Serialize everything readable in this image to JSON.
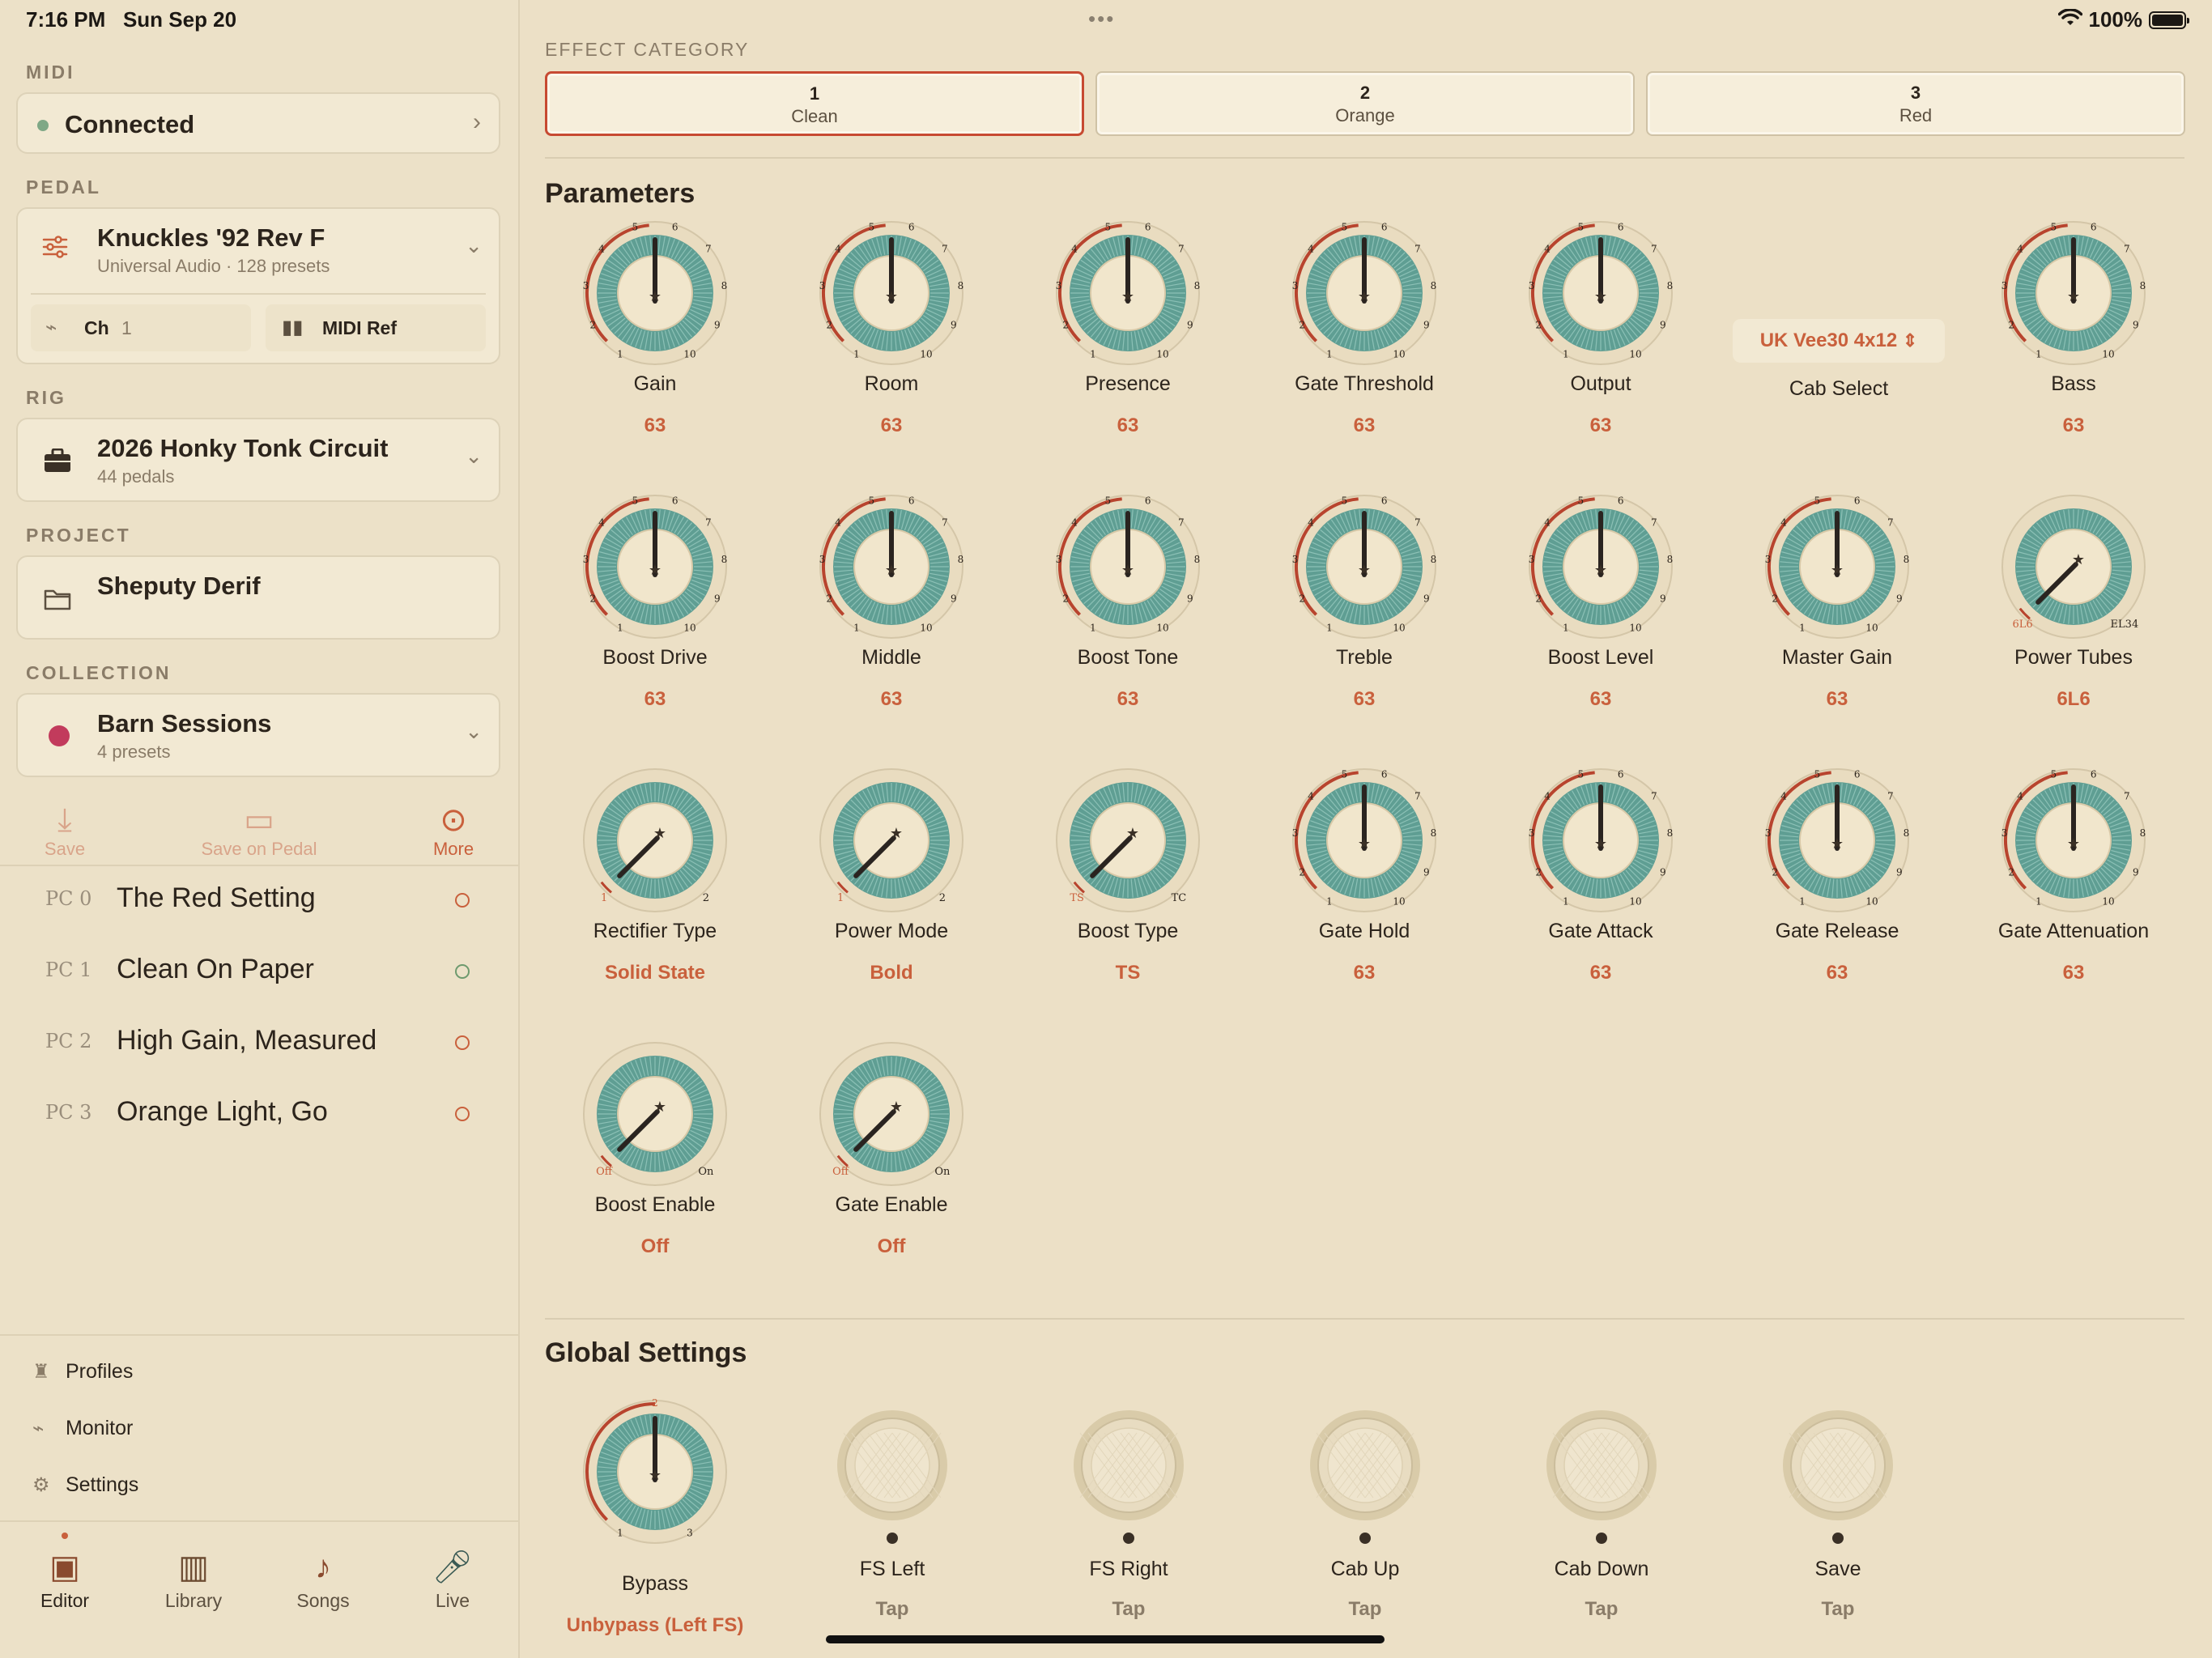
{
  "status": {
    "time": "7:16 PM",
    "date": "Sun Sep 20",
    "battery": "100%"
  },
  "sidebar": {
    "midi": {
      "label": "MIDI",
      "status": "Connected",
      "dot_color": "#7fa886"
    },
    "pedal": {
      "label": "PEDAL",
      "name": "Knuckles '92 Rev F",
      "sub": "Universal Audio · 128 presets",
      "ch_label": "Ch",
      "ch_value": "1",
      "midi_ref": "MIDI Ref"
    },
    "rig": {
      "label": "RIG",
      "name": "2026 Honky Tonk Circuit",
      "sub": "44 pedals"
    },
    "project": {
      "label": "PROJECT",
      "name": "Sheputy Derif"
    },
    "collection": {
      "label": "COLLECTION",
      "name": "Barn Sessions",
      "sub": "4 presets",
      "dot_color": "#c23b5c"
    },
    "actions": {
      "save": "Save",
      "save_on_pedal": "Save on Pedal",
      "more": "More"
    },
    "presets": [
      {
        "pc": "PC 0",
        "name": "The Red Setting",
        "ring_color": "#c9603c"
      },
      {
        "pc": "PC 1",
        "name": "Clean On Paper",
        "ring_color": "#6e9a6e"
      },
      {
        "pc": "PC 2",
        "name": "High Gain, Measured",
        "ring_color": "#c9603c"
      },
      {
        "pc": "PC 3",
        "name": "Orange Light, Go",
        "ring_color": "#c9603c"
      }
    ],
    "nav": {
      "profiles": "Profiles",
      "monitor": "Monitor",
      "settings": "Settings"
    },
    "tabs": {
      "editor": "Editor",
      "library": "Library",
      "songs": "Songs",
      "live": "Live"
    }
  },
  "main": {
    "category_label": "EFFECT CATEGORY",
    "categories": [
      {
        "num": "1",
        "label": "Clean",
        "selected": true
      },
      {
        "num": "2",
        "label": "Orange",
        "selected": false
      },
      {
        "num": "3",
        "label": "Red",
        "selected": false
      }
    ],
    "parameters_title": "Parameters",
    "global_title": "Global Settings",
    "knobs": [
      {
        "label": "Gain",
        "value": "63"
      },
      {
        "label": "Room",
        "value": "63"
      },
      {
        "label": "Presence",
        "value": "63"
      },
      {
        "label": "Gate Threshold",
        "value": "63"
      },
      {
        "label": "Output",
        "value": "63"
      },
      {
        "label": "Bass",
        "value": "63"
      },
      {
        "label": "Boost Drive",
        "value": "63"
      },
      {
        "label": "Middle",
        "value": "63"
      },
      {
        "label": "Boost Tone",
        "value": "63"
      },
      {
        "label": "Treble",
        "value": "63"
      },
      {
        "label": "Boost Level",
        "value": "63"
      },
      {
        "label": "Master Gain",
        "value": "63"
      },
      {
        "label": "Power Tubes",
        "value": "6L6",
        "min_label": "6L6",
        "max_label": "EL34"
      },
      {
        "label": "Rectifier Type",
        "value": "Solid State",
        "min_label": "1",
        "max_label": "2"
      },
      {
        "label": "Power Mode",
        "value": "Bold",
        "min_label": "1",
        "max_label": "2"
      },
      {
        "label": "Boost Type",
        "value": "TS",
        "min_label": "TS",
        "max_label": "TC"
      },
      {
        "label": "Gate Hold",
        "value": "63"
      },
      {
        "label": "Gate Attack",
        "value": "63"
      },
      {
        "label": "Gate Release",
        "value": "63"
      },
      {
        "label": "Gate Attenuation",
        "value": "63"
      },
      {
        "label": "Boost Enable",
        "value": "Off",
        "min_label": "Off",
        "max_label": "On"
      },
      {
        "label": "Gate Enable",
        "value": "Off",
        "min_label": "Off",
        "max_label": "On"
      }
    ],
    "cab_select": {
      "value": "UK Vee30 4x12",
      "label": "Cab Select"
    },
    "bypass": {
      "label": "Bypass",
      "value": "Unbypass (Left FS)",
      "ticks": [
        "1",
        "2",
        "3"
      ]
    },
    "footswitches": [
      {
        "label": "FS Left",
        "value": "Tap"
      },
      {
        "label": "FS Right",
        "value": "Tap"
      },
      {
        "label": "Cab Up",
        "value": "Tap"
      },
      {
        "label": "Cab Down",
        "value": "Tap"
      },
      {
        "label": "Save",
        "value": "Tap"
      }
    ],
    "colors": {
      "accent": "#c9603c",
      "teal": "#5f9e93",
      "selected_border": "#c74a32"
    }
  }
}
